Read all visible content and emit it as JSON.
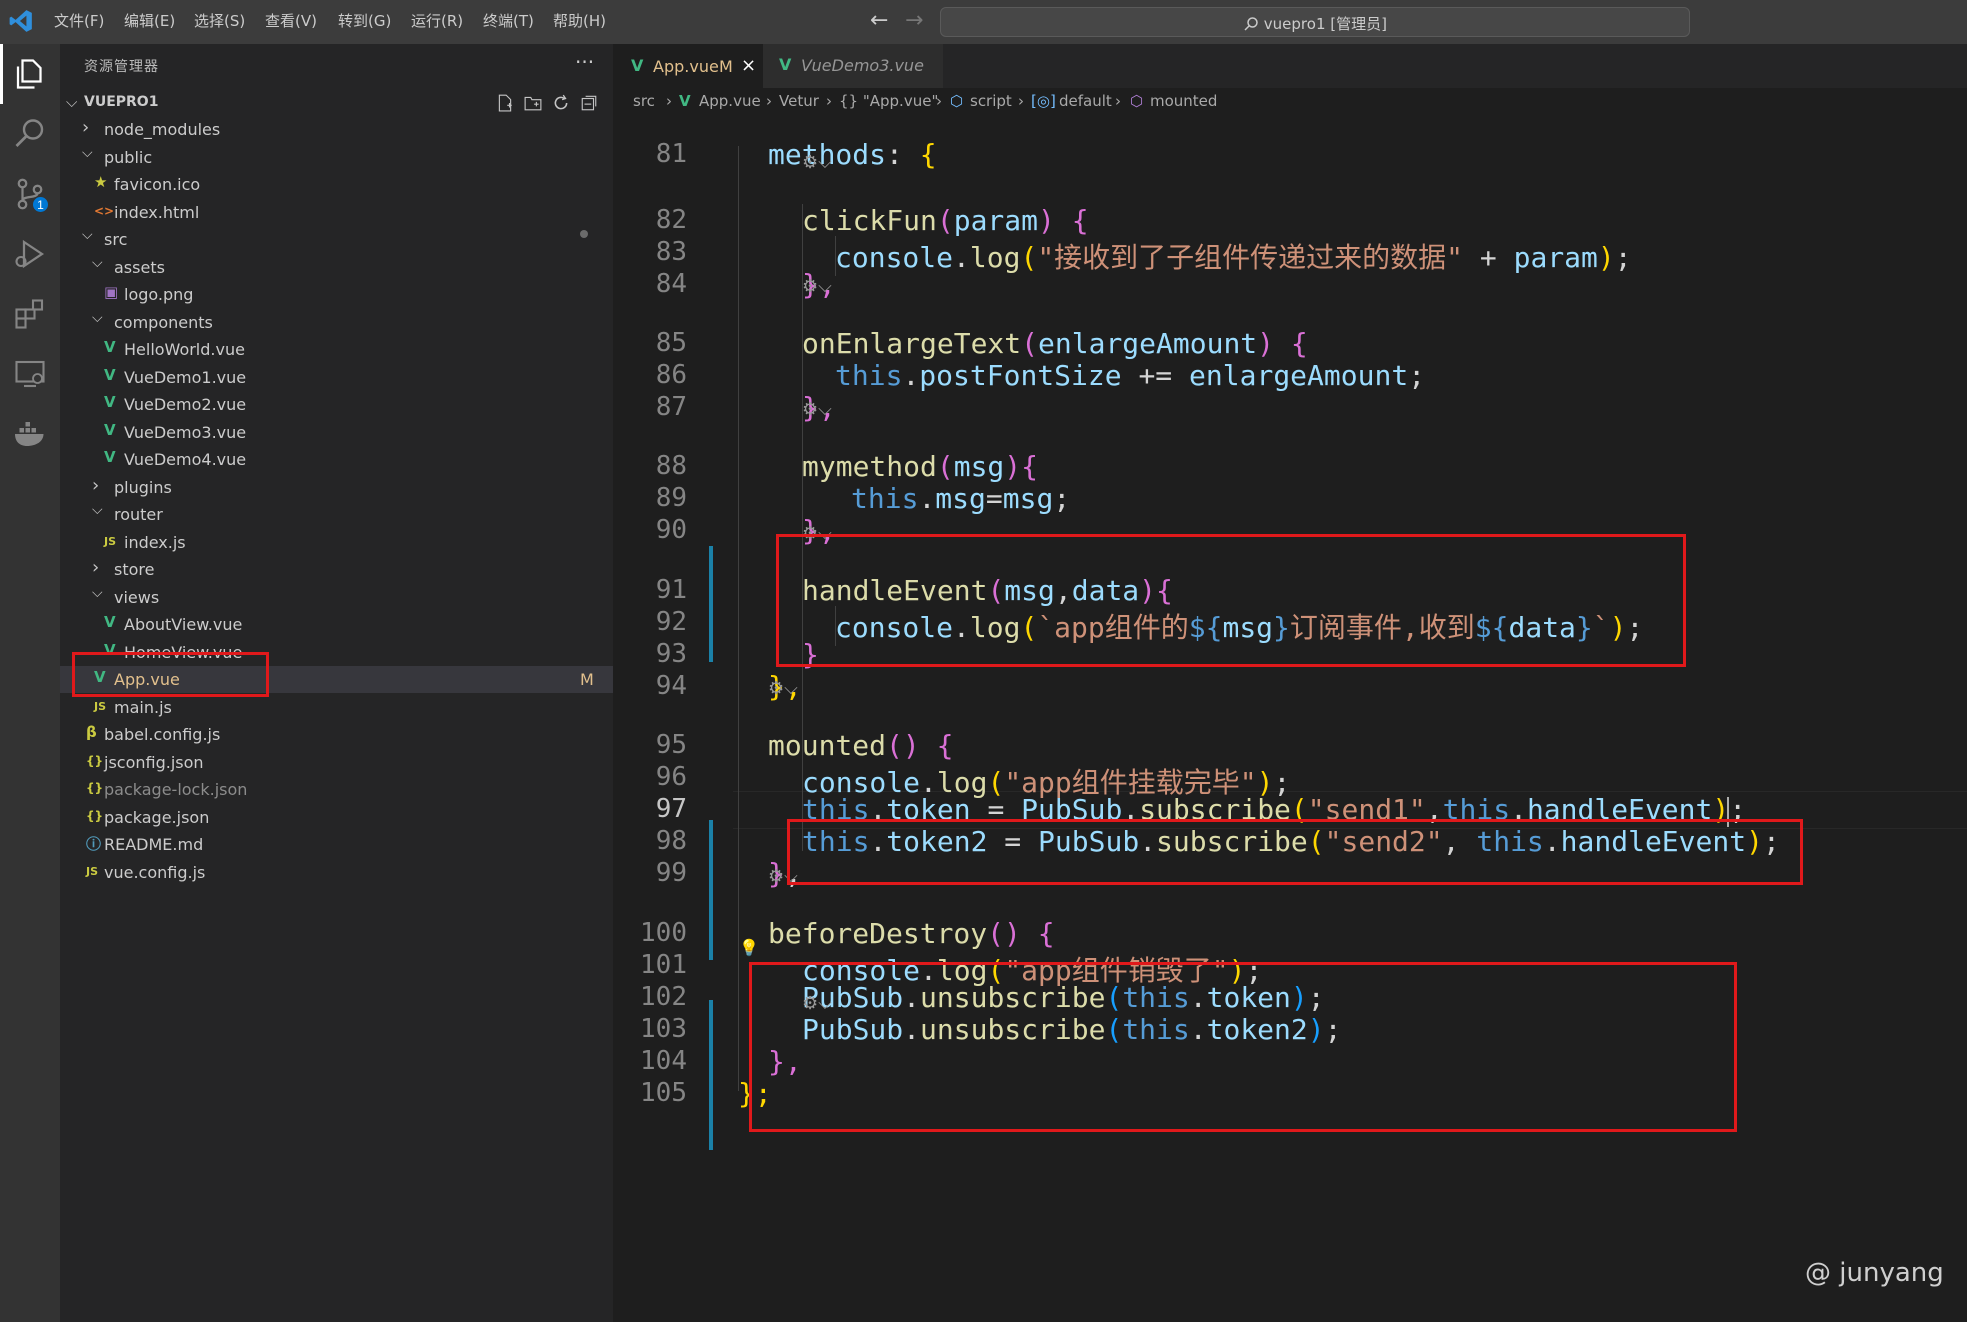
{
  "titlebar": {
    "menus": [
      "文件(F)",
      "编辑(E)",
      "选择(S)",
      "查看(V)",
      "转到(G)",
      "运行(R)",
      "终端(T)",
      "帮助(H)"
    ],
    "search_text": "vuepro1 [管理员]"
  },
  "sidebar": {
    "title": "资源管理器",
    "more": "···",
    "project": "VUEPRO1",
    "tree": [
      {
        "label": "node_modules",
        "kind": "folder",
        "open": false,
        "depth": 0
      },
      {
        "label": "public",
        "kind": "folder",
        "open": true,
        "depth": 0
      },
      {
        "label": "favicon.ico",
        "kind": "ico",
        "depth": 1
      },
      {
        "label": "index.html",
        "kind": "html",
        "depth": 1
      },
      {
        "label": "src",
        "kind": "folder",
        "open": true,
        "depth": 0
      },
      {
        "label": "assets",
        "kind": "folder",
        "open": true,
        "depth": 1
      },
      {
        "label": "logo.png",
        "kind": "png",
        "depth": 2
      },
      {
        "label": "components",
        "kind": "folder",
        "open": true,
        "depth": 1
      },
      {
        "label": "HelloWorld.vue",
        "kind": "vue",
        "depth": 2
      },
      {
        "label": "VueDemo1.vue",
        "kind": "vue",
        "depth": 2
      },
      {
        "label": "VueDemo2.vue",
        "kind": "vue",
        "depth": 2
      },
      {
        "label": "VueDemo3.vue",
        "kind": "vue",
        "depth": 2
      },
      {
        "label": "VueDemo4.vue",
        "kind": "vue",
        "depth": 2
      },
      {
        "label": "plugins",
        "kind": "folder",
        "open": false,
        "depth": 1
      },
      {
        "label": "router",
        "kind": "folder",
        "open": true,
        "depth": 1
      },
      {
        "label": "index.js",
        "kind": "js",
        "depth": 2
      },
      {
        "label": "store",
        "kind": "folder",
        "open": false,
        "depth": 1
      },
      {
        "label": "views",
        "kind": "folder",
        "open": true,
        "depth": 1
      },
      {
        "label": "AboutView.vue",
        "kind": "vue",
        "depth": 2
      },
      {
        "label": "HomeView.vue",
        "kind": "vue",
        "depth": 2
      },
      {
        "label": "App.vue",
        "kind": "vue",
        "depth": 1,
        "badge": "M",
        "selected": true
      },
      {
        "label": "main.js",
        "kind": "js",
        "depth": 1
      },
      {
        "label": "babel.config.js",
        "kind": "babel",
        "depth": 0
      },
      {
        "label": "jsconfig.json",
        "kind": "json",
        "depth": 0
      },
      {
        "label": "package-lock.json",
        "kind": "json",
        "depth": 0
      },
      {
        "label": "package.json",
        "kind": "json",
        "depth": 0
      },
      {
        "label": "README.md",
        "kind": "info",
        "depth": 0
      },
      {
        "label": "vue.config.js",
        "kind": "js",
        "depth": 0
      }
    ]
  },
  "tabs": [
    {
      "label": "App.vue",
      "badge": "M",
      "close": "×",
      "active": true
    },
    {
      "label": "VueDemo3.vue",
      "active": false
    }
  ],
  "breadcrumbs": [
    "src",
    "App.vue",
    "Vetur",
    "{} \"App.vue\"",
    "script",
    "default",
    "mounted"
  ],
  "editor": {
    "line_numbers": [
      "81",
      "82",
      "83",
      "84",
      "85",
      "86",
      "87",
      "88",
      "89",
      "90",
      "91",
      "92",
      "93",
      "94",
      "95",
      "96",
      "97",
      "98",
      "99",
      "100",
      "101",
      "102",
      "103",
      "104",
      "105"
    ],
    "lines": {
      "l81": [
        "methods",
        ":",
        " {"
      ],
      "l82": [
        "clickFun",
        "(",
        "param",
        ")",
        " {"
      ],
      "l83": [
        "console",
        ".",
        "log",
        "(",
        "\"接收到了子组件传递过来的数据\"",
        " + ",
        "param",
        ")",
        ";"
      ],
      "l84": [
        "},"
      ],
      "l85": [
        "onEnlargeText",
        "(",
        "enlargeAmount",
        ")",
        " {"
      ],
      "l86": [
        "this",
        ".",
        "postFontSize",
        " += ",
        "enlargeAmount",
        ";"
      ],
      "l87": [
        "},"
      ],
      "l88": [
        "mymethod",
        "(",
        "msg",
        ")",
        "{"
      ],
      "l89": [
        "this",
        ".",
        "msg",
        "=",
        "msg",
        ";"
      ],
      "l90": [
        "},"
      ],
      "l91": [
        "handleEvent",
        "(",
        "msg",
        ",",
        "data",
        ")",
        "{"
      ],
      "l92": [
        "console",
        ".",
        "log",
        "(",
        "`app组件的",
        "${",
        "msg",
        "}",
        "订阅事件,收到",
        "${",
        "data",
        "}",
        "`",
        ")",
        ";"
      ],
      "l93": [
        "}"
      ],
      "l94": [
        "},"
      ],
      "l95": [
        "mounted",
        "()",
        " {"
      ],
      "l96": [
        "console",
        ".",
        "log",
        "(",
        "\"app组件挂载完毕\"",
        ")",
        ";"
      ],
      "l97": [
        "this",
        ".",
        "token",
        " = ",
        "PubSub",
        ".",
        "subscribe",
        "(",
        "\"send1\"",
        ",",
        "this",
        ".",
        "handleEvent",
        ")",
        ";"
      ],
      "l98": [
        "this",
        ".",
        "token2",
        " = ",
        "PubSub",
        ".",
        "subscribe",
        "(",
        "\"send2\"",
        ", ",
        "this",
        ".",
        "handleEvent",
        ")",
        ";"
      ],
      "l99": [
        "}",
        ","
      ],
      "l100": [
        "beforeDestroy",
        "()",
        " {"
      ],
      "l101": [
        "console",
        ".",
        "log",
        "(",
        "\"app组件销毁了\"",
        ")",
        ";"
      ],
      "l102": [
        "PubSub",
        ".",
        "unsubscribe",
        "(",
        "this",
        ".",
        "token",
        ")",
        ";"
      ],
      "l103": [
        "PubSub",
        ".",
        "unsubscribe",
        "(",
        "this",
        ".",
        "token2",
        ")",
        ";"
      ],
      "l104": [
        "},"
      ],
      "l105": [
        "};"
      ]
    }
  },
  "watermark": "@ junyang",
  "colors": {
    "accent": "#007acc",
    "highlight_box": "#e0191b",
    "vue_green": "#41b883",
    "modified": "#e2c08d"
  }
}
